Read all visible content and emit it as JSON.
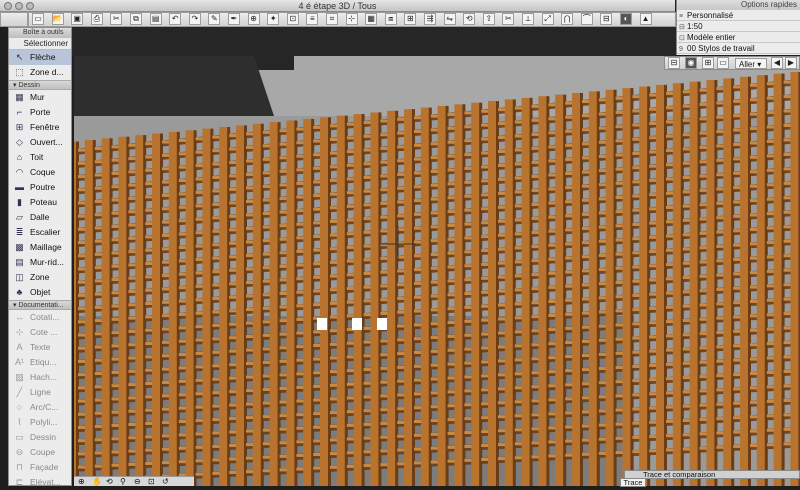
{
  "window": {
    "title": "4 é étape 3D / Tous"
  },
  "toolbox": {
    "header": "Boîte à outils",
    "select_label": "Sélectionner",
    "top_tools": [
      {
        "label": "Flèche",
        "icon": "arrow-icon",
        "glyph": "↖",
        "active": true
      },
      {
        "label": "Zone d...",
        "icon": "marquee-icon",
        "glyph": "⬚",
        "active": false
      }
    ],
    "section_draw": "Dessin",
    "draw_tools": [
      {
        "label": "Mur",
        "icon": "wall-icon",
        "glyph": "▦"
      },
      {
        "label": "Porte",
        "icon": "door-icon",
        "glyph": "⌐"
      },
      {
        "label": "Fenêtre",
        "icon": "window-icon",
        "glyph": "⊞"
      },
      {
        "label": "Ouvert...",
        "icon": "opening-icon",
        "glyph": "◇"
      },
      {
        "label": "Toit",
        "icon": "roof-icon",
        "glyph": "⌂"
      },
      {
        "label": "Coque",
        "icon": "shell-icon",
        "glyph": "◠"
      },
      {
        "label": "Poutre",
        "icon": "beam-icon",
        "glyph": "▬"
      },
      {
        "label": "Poteau",
        "icon": "column-icon",
        "glyph": "▮"
      },
      {
        "label": "Dalle",
        "icon": "slab-icon",
        "glyph": "▱"
      },
      {
        "label": "Escalier",
        "icon": "stair-icon",
        "glyph": "≣"
      },
      {
        "label": "Maillage",
        "icon": "mesh-icon",
        "glyph": "▩"
      },
      {
        "label": "Mur-rid...",
        "icon": "curtain-wall-icon",
        "glyph": "▤"
      },
      {
        "label": "Zone",
        "icon": "zone-icon",
        "glyph": "◫"
      },
      {
        "label": "Objet",
        "icon": "object-icon",
        "glyph": "♣"
      }
    ],
    "section_doc": "Documentati...",
    "doc_tools": [
      {
        "label": "Cotati...",
        "icon": "dimension-icon",
        "glyph": "↔"
      },
      {
        "label": "Cote ...",
        "icon": "level-dimension-icon",
        "glyph": "⊹"
      },
      {
        "label": "Texte",
        "icon": "text-icon",
        "glyph": "A"
      },
      {
        "label": "Etiqu...",
        "icon": "label-icon",
        "glyph": "A¹"
      },
      {
        "label": "Hach...",
        "icon": "hatch-icon",
        "glyph": "▨"
      },
      {
        "label": "Ligne",
        "icon": "line-icon",
        "glyph": "╱"
      },
      {
        "label": "Arc/C...",
        "icon": "arc-icon",
        "glyph": "○"
      },
      {
        "label": "Polyli...",
        "icon": "polyline-icon",
        "glyph": "⌇"
      },
      {
        "label": "Dessin",
        "icon": "drawing-icon",
        "glyph": "▭"
      },
      {
        "label": "Coupe",
        "icon": "section-icon",
        "glyph": "⊖"
      },
      {
        "label": "Façade",
        "icon": "elevation-icon",
        "glyph": "⊓"
      },
      {
        "label": "Elévat...",
        "icon": "interior-elevation-icon",
        "glyph": "⊏"
      }
    ]
  },
  "quick_options": {
    "header": "Options rapides",
    "rows": [
      "Personnalisé",
      "1:50",
      "Modèle entier",
      "00 Stylos de travail"
    ]
  },
  "nav": {
    "goto_label": "Aller"
  },
  "trace_panel": {
    "title": "Trace et comparaison",
    "tab": "Trace"
  },
  "colors": {
    "wood": "#b8732f",
    "wood_dark": "#6a3d16",
    "sky": "#a8a8a8",
    "dark_block": "#262626"
  }
}
